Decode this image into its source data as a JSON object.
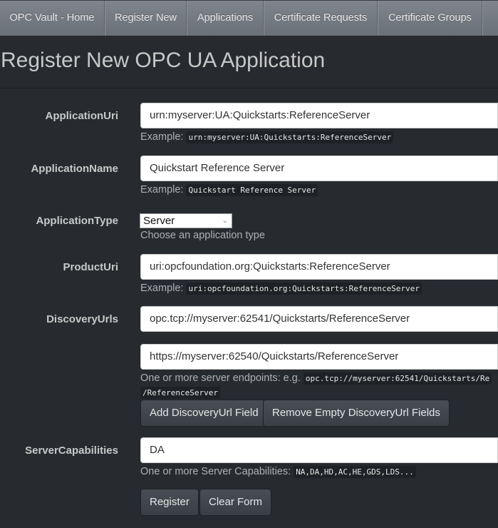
{
  "nav": {
    "items": [
      "OPC Vault - Home",
      "Register New",
      "Applications",
      "Certificate Requests",
      "Certificate Groups"
    ]
  },
  "page_title": "Register New OPC UA Application",
  "form": {
    "application_uri": {
      "label": "ApplicationUri",
      "value": "urn:myserver:UA:Quickstarts:ReferenceServer",
      "help": "Example:",
      "example": "urn:myserver:UA:Quickstarts:ReferenceServer"
    },
    "application_name": {
      "label": "ApplicationName",
      "value": "Quickstart Reference Server",
      "help": "Example:",
      "example": "Quickstart Reference Server"
    },
    "application_type": {
      "label": "ApplicationType",
      "selected": "Server",
      "help": "Choose an application type"
    },
    "product_uri": {
      "label": "ProductUri",
      "value": "uri:opcfoundation.org:Quickstarts:ReferenceServer",
      "help": "Example:",
      "example": "uri:opcfoundation.org:Quickstarts:ReferenceServer"
    },
    "discovery_urls": {
      "label": "DiscoveryUrls",
      "values": [
        "opc.tcp://myserver:62541/Quickstarts/ReferenceServer",
        "https://myserver:62540/Quickstarts/ReferenceServer"
      ],
      "help": "One or more server endpoints: e.g.",
      "example_line1": "opc.tcp://myserver:62541/Quickstarts/Re",
      "example_line2": "/ReferenceServer",
      "add_button": "Add DiscoveryUrl Field",
      "remove_button": "Remove Empty DiscoveryUrl Fields"
    },
    "server_capabilities": {
      "label": "ServerCapabilities",
      "value": "DA",
      "help": "One or more Server Capabilities:",
      "example": "NA,DA,HD,AC,HE,GDS,LDS..."
    },
    "register_button": "Register",
    "clear_button": "Clear Form"
  }
}
